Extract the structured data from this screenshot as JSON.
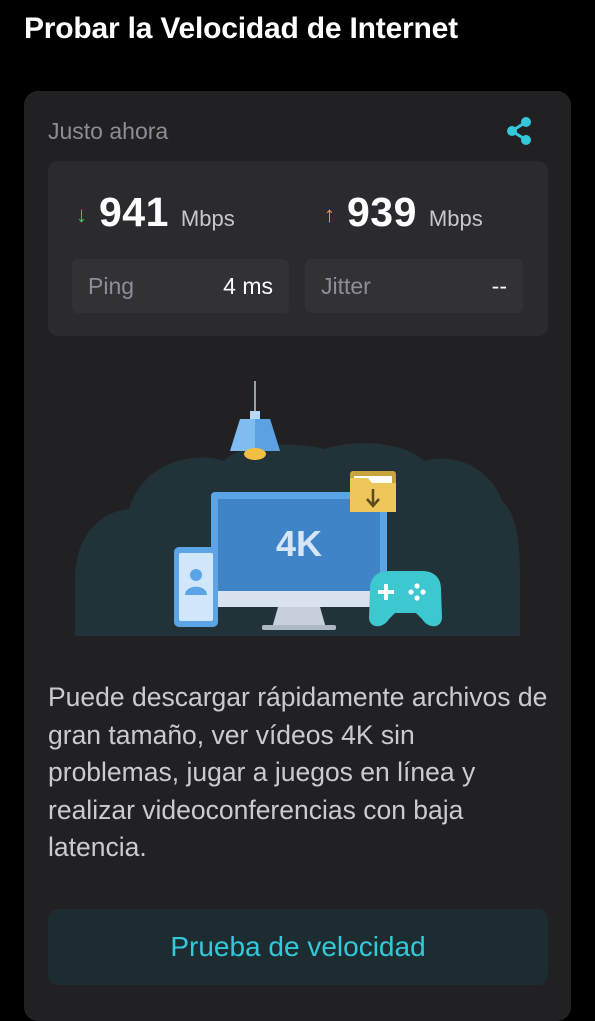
{
  "header": {
    "title": "Probar la Velocidad de Internet"
  },
  "result_card": {
    "timestamp": "Justo ahora",
    "share_icon": "share-icon",
    "download": {
      "arrow": "↓",
      "value": "941",
      "unit": "Mbps",
      "color": "#3ad06a"
    },
    "upload": {
      "arrow": "↑",
      "value": "939",
      "unit": "Mbps",
      "color": "#f29b2b"
    },
    "ping": {
      "label": "Ping",
      "value": "4 ms"
    },
    "jitter": {
      "label": "Jitter",
      "value": "--"
    },
    "illustration": {
      "monitor_text": "4K",
      "icons": [
        "lamp-icon",
        "monitor-icon",
        "phone-icon",
        "folder-download-icon",
        "gamepad-icon"
      ]
    },
    "description": "Puede descargar rápidamente archivos de gran tamaño, ver vídeos 4K sin problemas, jugar a juegos en línea y realizar videoconferencias con baja latencia.",
    "button_label": "Prueba de velocidad"
  },
  "colors": {
    "accent": "#33c9d8",
    "background": "#000000",
    "card": "#212124"
  }
}
